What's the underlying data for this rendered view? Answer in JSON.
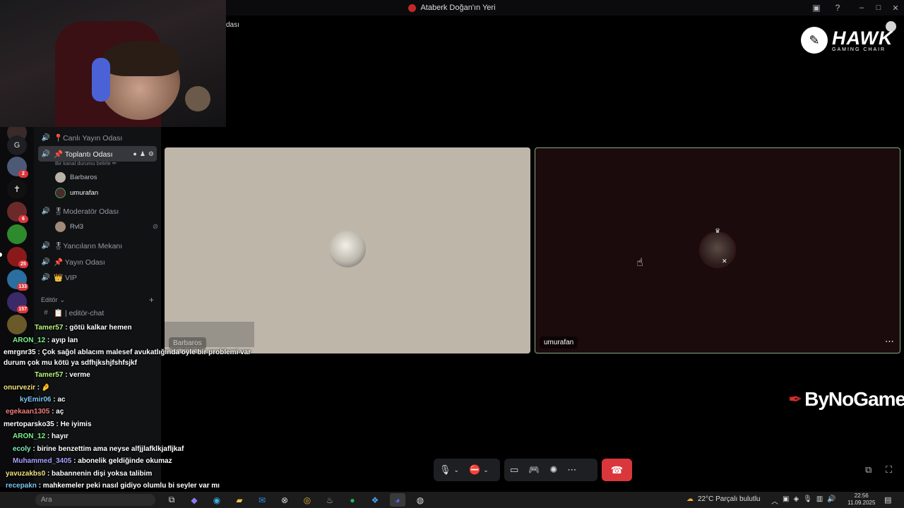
{
  "window": {
    "title": "Ataberk Doğan'ın Yeri",
    "controls": [
      "–",
      "□",
      "✕"
    ]
  },
  "webcam_overlay_tail": "dası",
  "rail": {
    "badges": [
      "2",
      "6",
      "25",
      "133",
      "157"
    ]
  },
  "channels": {
    "items": [
      {
        "name": "📍Canlı Yayın Odası"
      },
      {
        "name": "📌 Toplantı Odası",
        "status": "Bir kanal durumu belirle ✏"
      },
      {
        "name": "🎖Moderatör Odası"
      },
      {
        "name": "🎖Yancıların Mekanı"
      },
      {
        "name": "📌 Yayın Odası"
      },
      {
        "name": "👑 VIP"
      }
    ],
    "members_toplanti": [
      "Barbaros",
      "umurafan"
    ],
    "members_moderator": [
      "Rvl3"
    ],
    "category": "Editör",
    "text_channel": "📋 | editör-chat"
  },
  "stage": {
    "left_name": "Barbaros",
    "right_name": "umurafan"
  },
  "sponsors": {
    "hawk_big": "HAWK",
    "hawk_small": "GAMING CHAIR",
    "bynogame": "ByNoGame"
  },
  "chat": [
    {
      "user": "Tamer57",
      "msg": ": götü kalkar hemen",
      "color": "#b9f27c"
    },
    {
      "user": "ARON_12",
      "msg": ": ayıp lan",
      "color": "#7cf28a"
    },
    {
      "user": "emrgnr35",
      "msg": ": Çok sağol ablacım malesef avukatlığında öyle bir problemi var",
      "color": "#ffffff"
    },
    {
      "user": "",
      "msg": "durum çok mu kötü ya sdfhjkshjfshfsjkf",
      "color": "#ffffff"
    },
    {
      "user": "Tamer57",
      "msg": ": verme",
      "color": "#b9f27c"
    },
    {
      "user": "onurvezir",
      "msg": ": 🤌",
      "color": "#f2e27c"
    },
    {
      "user": "kyEmir06",
      "msg": ": ac",
      "color": "#7cc7f2"
    },
    {
      "user": "egekaan1305",
      "msg": ": aç",
      "color": "#f27c7c"
    },
    {
      "user": "mertoparsko35",
      "msg": ": He iyimis",
      "color": "#ffffff"
    },
    {
      "user": "ARON_12",
      "msg": ": hayır",
      "color": "#7cf28a"
    },
    {
      "user": "ecoly",
      "msg": ": birine benzettim ama neyse alfjjlafklkjafljkaf",
      "color": "#7cf2c0"
    },
    {
      "user": "Muhammed_3405",
      "msg": ": abonelik geldiğinde okumaz",
      "color": "#a9a2ff"
    },
    {
      "user": "yavuzakbs0",
      "msg": ": babannenin dişi yoksa talibim",
      "color": "#f2e27c"
    },
    {
      "user": "recepakn",
      "msg": ": mahkemeler peki nasıl gidiyo olumlu bi seyler var mı",
      "color": "#7cc7f2"
    }
  ],
  "taskbar": {
    "search_placeholder": "Ara",
    "weather": "22°C  Parçalı bulutlu",
    "time": "22:56",
    "date": "11.09.2025"
  }
}
